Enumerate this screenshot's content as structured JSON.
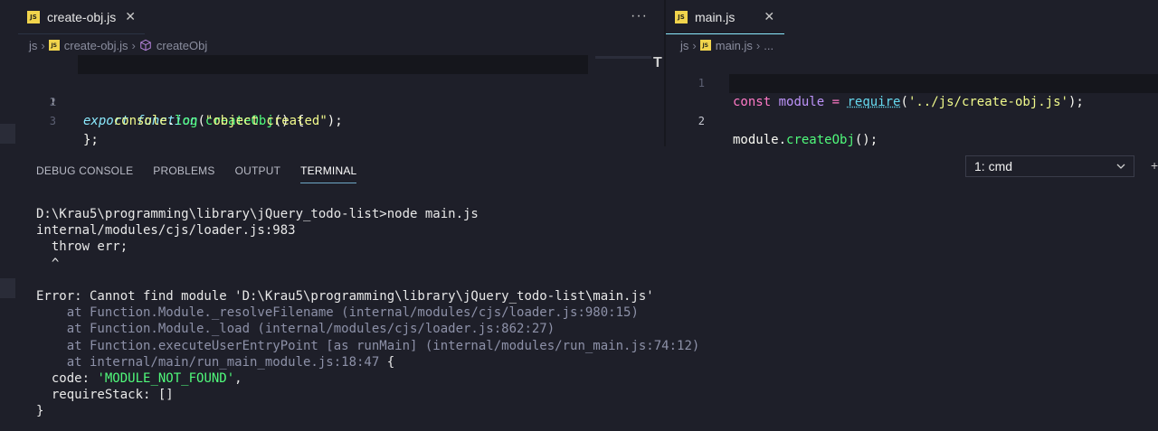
{
  "left_editor": {
    "tab": {
      "badge": "JS",
      "label": "create-obj.js",
      "close": "✕"
    },
    "more": "···",
    "breadcrumb": {
      "folder": "js",
      "file": "create-obj.js",
      "symbol": "createObj"
    },
    "lines": [
      "1",
      "2",
      "3"
    ],
    "code": {
      "l1_export": "export",
      "l1_function": "function",
      "l1_name": "createObj",
      "l1_rest": "() {",
      "l2_console": "console",
      "l2_dot": ".",
      "l2_log": "log",
      "l2_open": "(",
      "l2_str": "\"object created\"",
      "l2_close": ");",
      "l3": "};"
    }
  },
  "right_editor": {
    "tab": {
      "badge": "JS",
      "label": "main.js",
      "close": "✕"
    },
    "breadcrumb": {
      "folder": "js",
      "file": "main.js",
      "rest": "..."
    },
    "lines": [
      "1",
      "2"
    ],
    "code": {
      "l1_const": "const",
      "l1_module": "module",
      "l1_eq": "=",
      "l1_require": "require",
      "l1_open": "(",
      "l1_str": "'../js/create-obj.js'",
      "l1_close": ");",
      "l2_module": "module",
      "l2_dot": ".",
      "l2_fn": "createObj",
      "l2_rest": "();"
    }
  },
  "panel": {
    "tabs": [
      "DEBUG CONSOLE",
      "PROBLEMS",
      "OUTPUT",
      "TERMINAL"
    ],
    "active_tab": "TERMINAL",
    "terminal_select": "1: cmd",
    "plus": "+"
  },
  "terminal": {
    "l1": "D:\\Krau5\\programming\\library\\jQuery_todo-list>node main.js",
    "l2": "internal/modules/cjs/loader.js:983",
    "l3": "  throw err;",
    "l4": "  ^",
    "l5": "",
    "l6": "Error: Cannot find module 'D:\\Krau5\\programming\\library\\jQuery_todo-list\\main.js'",
    "l7": "    at Function.Module._resolveFilename (internal/modules/cjs/loader.js:980:15)",
    "l8": "    at Function.Module._load (internal/modules/cjs/loader.js:862:27)",
    "l9": "    at Function.executeUserEntryPoint [as runMain] (internal/modules/run_main.js:74:12)",
    "l10": "    at internal/main/run_main_module.js:18:47",
    "l10_brace": " {",
    "l11_key": "  code: ",
    "l11_val": "'MODULE_NOT_FOUND'",
    "l11_comma": ",",
    "l12": "  requireStack: []",
    "l13": "}"
  },
  "colors": {
    "background": "#1e1f29",
    "keyword_italic": "#8be9fd",
    "function": "#50fa7b",
    "string": "#f1fa8c",
    "constant": "#bd93f9",
    "js_badge": "#f1d44c"
  }
}
